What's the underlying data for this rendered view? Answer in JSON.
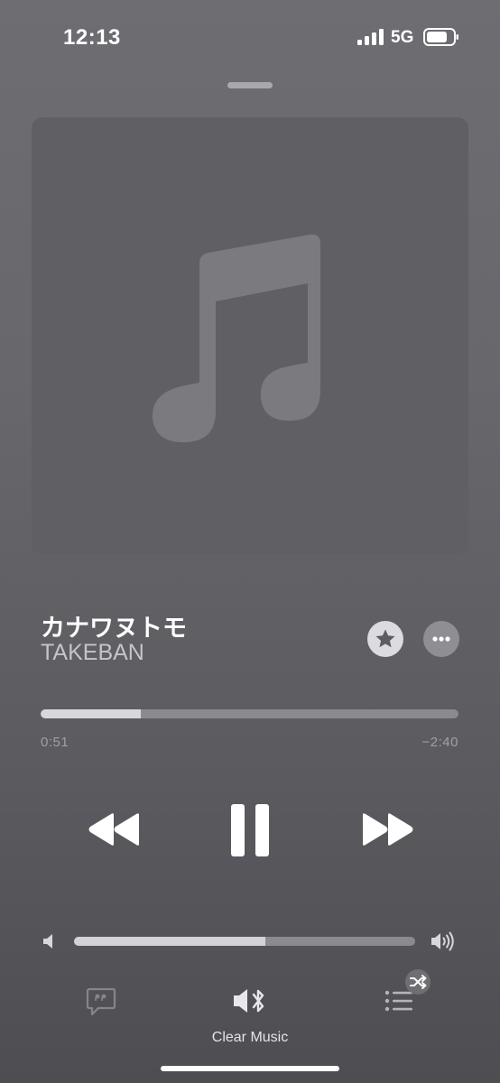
{
  "status_bar": {
    "time": "12:13",
    "network": "5G"
  },
  "now_playing": {
    "title": "カナワヌトモ",
    "artist": "TAKEBAN",
    "elapsed": "0:51",
    "remaining": "−2:40",
    "progress_fraction": 0.24,
    "is_playing": true
  },
  "volume": {
    "level_fraction": 0.56
  },
  "output_device": {
    "label": "Clear Music"
  },
  "icons": {
    "artwork_placeholder": "music-note-icon",
    "favorite": "star-icon",
    "more": "ellipsis-icon",
    "rewind": "backward-icon",
    "pause": "pause-icon",
    "forward": "forward-icon",
    "volume_low": "speaker-low-icon",
    "volume_high": "speaker-high-icon",
    "lyrics": "quote-bubble-icon",
    "airplay": "speaker-bluetooth-icon",
    "queue": "list-icon",
    "shuffle": "shuffle-icon"
  },
  "colors": {
    "accent": "#ffffff",
    "progress_fill": "#d8d8dc",
    "track": "#8a8a8f"
  }
}
